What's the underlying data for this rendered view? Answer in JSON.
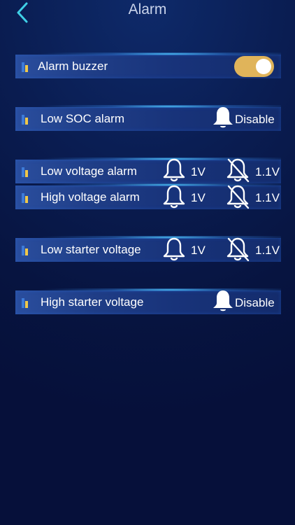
{
  "header": {
    "title": "Alarm"
  },
  "rows": [
    {
      "label": "Alarm buzzer"
    },
    {
      "label": "Low SOC alarm",
      "status": "Disable"
    },
    {
      "label": "Low voltage alarm",
      "alarm_value": "1V",
      "silent_value": "1.1V"
    },
    {
      "label": "High voltage alarm",
      "alarm_value": "1V",
      "silent_value": "1.1V"
    },
    {
      "label": "Low starter voltage",
      "alarm_value": "1V",
      "silent_value": "1.1V"
    },
    {
      "label": "High starter voltage",
      "status": "Disable"
    }
  ],
  "colors": {
    "toggle_on": "#e0b45a",
    "marker_blue": "#3d7bd8",
    "marker_yellow": "#f0c84a",
    "back_arrow": "#3fd0e6"
  }
}
